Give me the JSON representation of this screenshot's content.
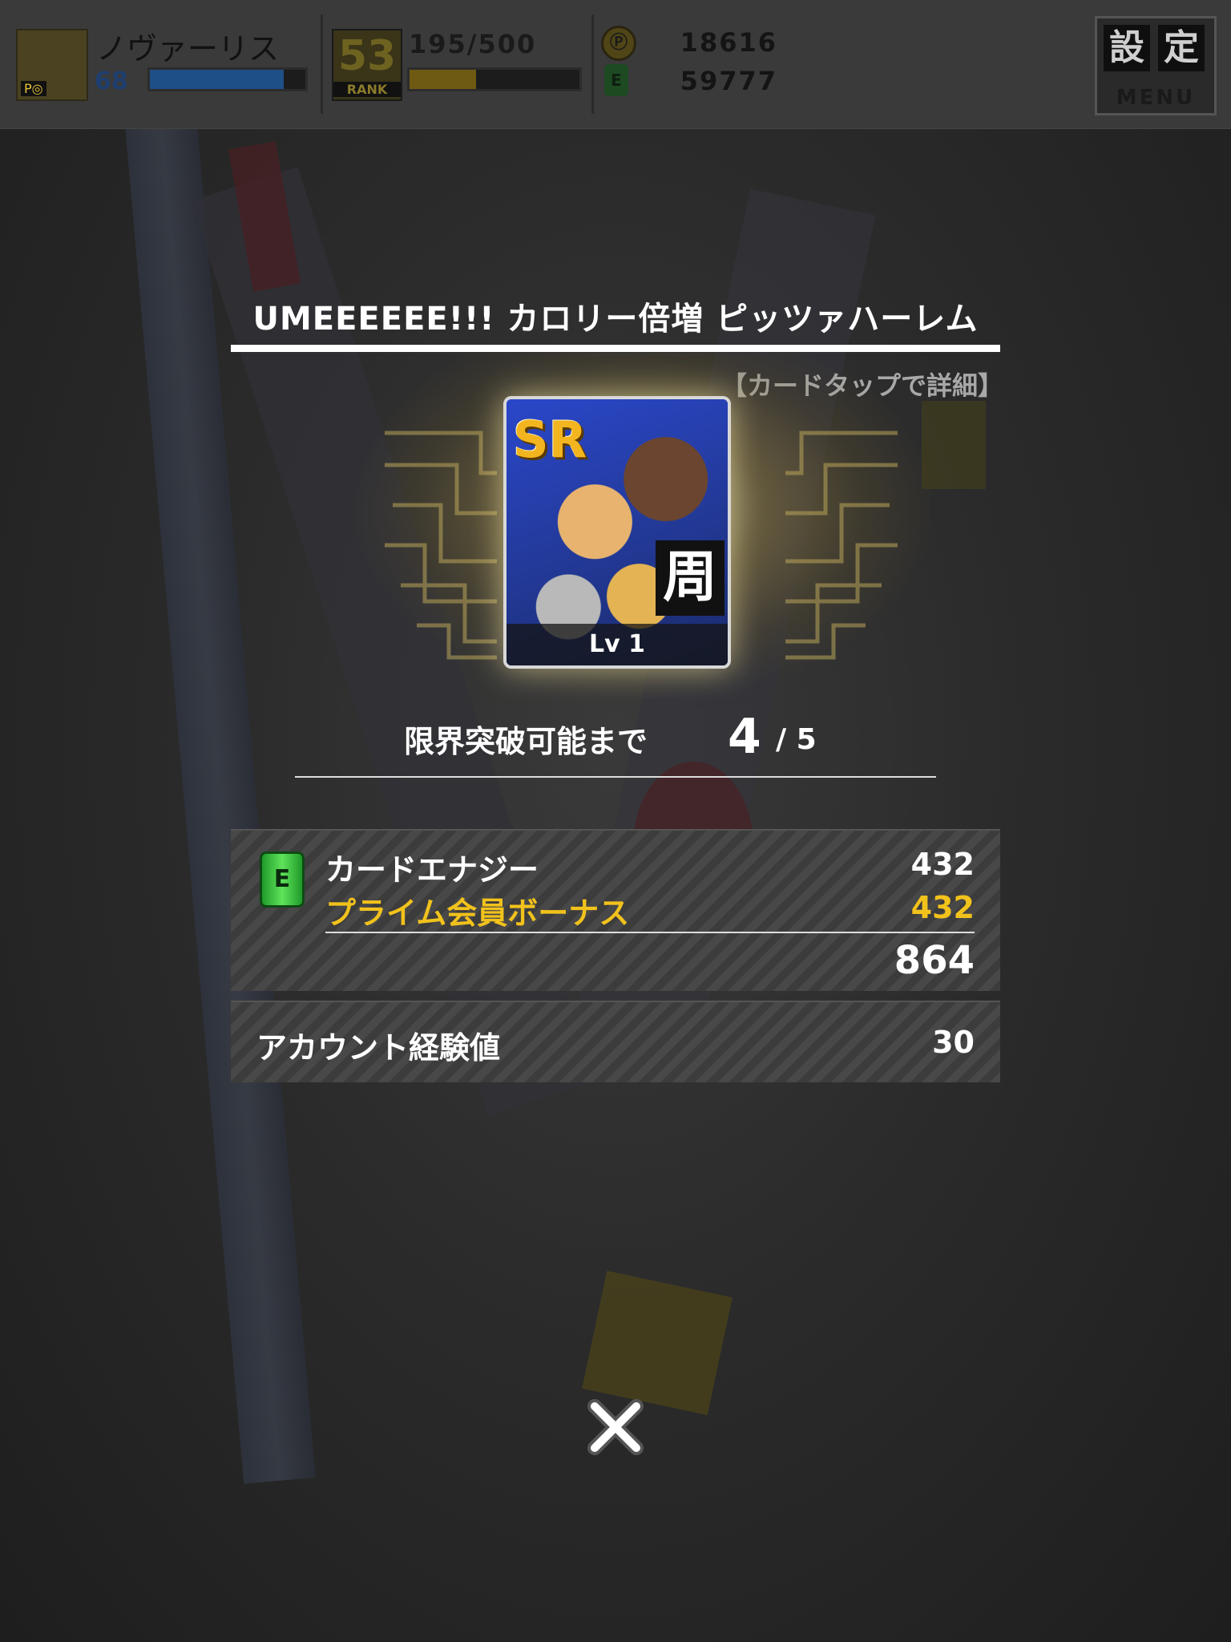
{
  "header": {
    "player_name": "ノヴァーリス",
    "player_level": "68",
    "player_tag": "P◎",
    "rank_number": "53",
    "rank_label": "RANK",
    "stamina_text": "195/500",
    "coin_symbol": "Ⓟ",
    "energy_symbol": "E",
    "coins": "18616",
    "energy": "59777",
    "menu_kanji_1": "設",
    "menu_kanji_2": "定",
    "menu_label": "MENU",
    "exp_fill_percent": 86,
    "stamina_fill_percent": 39,
    "colors": {
      "exp_bar": "#1e4f86",
      "stamina_bar": "#6f5a14"
    }
  },
  "result": {
    "card_title": "UMEEEEEE!!! カロリー倍増 ピッツァハーレム",
    "detail_hint": "【カードタップで詳細】",
    "card": {
      "rarity": "SR",
      "type_kanji": "周",
      "level_text": "Lv 1"
    },
    "limit_break": {
      "label": "限界突破可能まで",
      "current": "4",
      "max": "/ 5"
    },
    "card_energy": {
      "icon": "energy-can-icon",
      "label": "カードエナジー",
      "value": "432",
      "bonus_label": "プライム会員ボーナス",
      "bonus_value": "432",
      "total": "864"
    },
    "account_exp": {
      "label": "アカウント経験値",
      "value": "30"
    },
    "close_icon": "close-icon",
    "colors": {
      "bonus": "#f2c21c"
    }
  }
}
